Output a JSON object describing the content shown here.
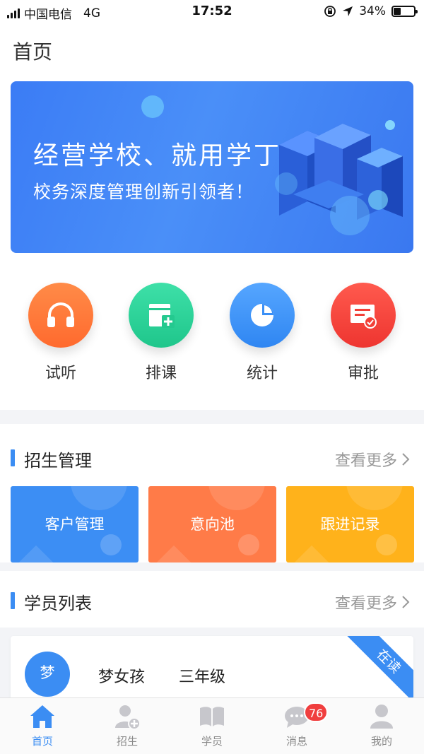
{
  "status_bar": {
    "carrier": "中国电信",
    "network": "4G",
    "time": "17:52",
    "battery": "34%",
    "battery_level": 0.34
  },
  "page_title": "首页",
  "banner": {
    "headline": "经营学校、就用学丁",
    "subline": "校务深度管理创新引领者！"
  },
  "quick_actions": [
    {
      "label": "试听",
      "icon": "headphones-icon",
      "color": "#ff7a3d"
    },
    {
      "label": "排课",
      "icon": "schedule-add-icon",
      "color": "#2ed39b"
    },
    {
      "label": "统计",
      "icon": "pie-chart-icon",
      "color": "#3c93f7"
    },
    {
      "label": "审批",
      "icon": "approval-icon",
      "color": "#f4453c"
    }
  ],
  "enrollment": {
    "title": "招生管理",
    "more": "查看更多",
    "cards": [
      {
        "label": "客户管理",
        "color": "#3c8ef4"
      },
      {
        "label": "意向池",
        "color": "#ff7b48"
      },
      {
        "label": "跟进记录",
        "color": "#ffb21b"
      }
    ]
  },
  "students": {
    "title": "学员列表",
    "more": "查看更多",
    "first": {
      "avatar": "梦",
      "name": "梦女孩",
      "grade": "三年级",
      "status": "在读"
    }
  },
  "tabs": [
    {
      "label": "首页",
      "icon": "home-icon"
    },
    {
      "label": "招生",
      "icon": "add-user-icon"
    },
    {
      "label": "学员",
      "icon": "book-icon"
    },
    {
      "label": "消息",
      "icon": "chat-icon",
      "badge": "76"
    },
    {
      "label": "我的",
      "icon": "profile-icon"
    }
  ],
  "colors": {
    "accent": "#3b8df3",
    "inactive": "#c7c7cc"
  }
}
